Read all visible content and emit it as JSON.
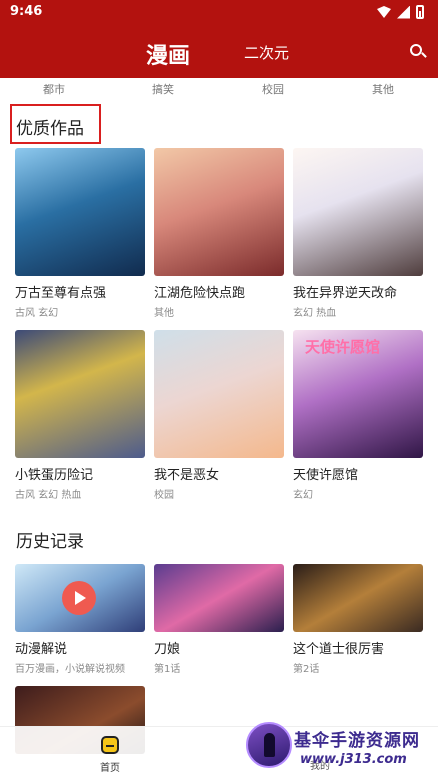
{
  "status_bar": {
    "time": "9:46"
  },
  "app_bar": {
    "active_tab": "漫画",
    "other_tab": "二次元"
  },
  "categories": [
    "都市",
    "搞笑",
    "校园",
    "其他"
  ],
  "quality_section": {
    "title": "优质作品",
    "items": [
      {
        "title": "万古至尊有点强",
        "tags": "古风 玄幻"
      },
      {
        "title": "江湖危险快点跑",
        "tags": "其他"
      },
      {
        "title": "我在异界逆天改命",
        "tags": "玄幻 热血"
      },
      {
        "title": "小铁蛋历险记",
        "tags": "古风 玄幻 热血"
      },
      {
        "title": "我不是恶女",
        "tags": "校园"
      },
      {
        "title": "天使许愿馆",
        "tags": "玄幻"
      }
    ],
    "cover_text": "天使许愿馆"
  },
  "history_section": {
    "title": "历史记录",
    "items": [
      {
        "title": "动漫解说",
        "subtitle": "百万漫画，小说解说视频"
      },
      {
        "title": "刀娘",
        "subtitle": "第1话"
      },
      {
        "title": "这个道士很厉害",
        "subtitle": "第2话"
      }
    ]
  },
  "bottom_nav": {
    "home": "首页",
    "other": "我的"
  },
  "watermark": {
    "title": "基伞手游资源网",
    "url": "www.j313.com"
  },
  "colors": {
    "brand": "#b3120f",
    "highlight_box": "#d91f1f"
  }
}
